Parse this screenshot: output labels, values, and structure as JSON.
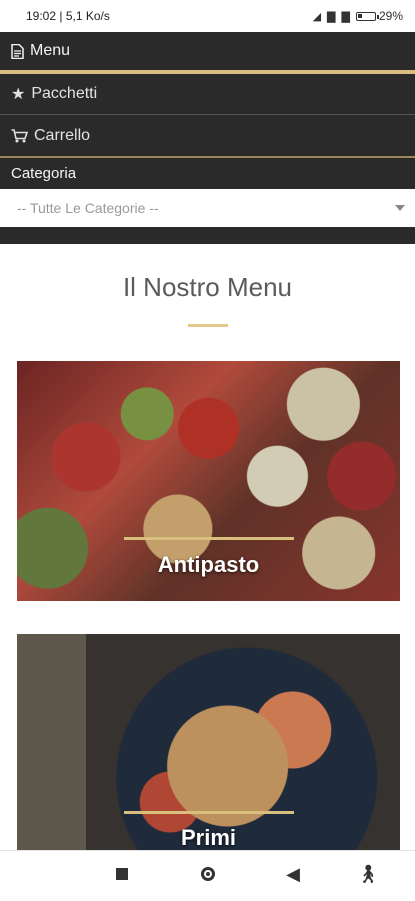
{
  "status_bar": {
    "time": "19:02",
    "speed": "5,1 Ko/s",
    "signal1": "⁴ᴳ",
    "signal2": "⁴ᴳ",
    "battery_text": "29%",
    "battery_level": 0.29
  },
  "nav": {
    "menu_label": "Menu",
    "packages_label": "Pacchetti",
    "cart_label": "Carrello",
    "category_label": "Categoria",
    "category_select_value": "-- Tutte Le Categorie --"
  },
  "main": {
    "heading": "Il Nostro Menu",
    "cards": [
      {
        "title": "Antipasto"
      },
      {
        "title": "Primi"
      }
    ]
  },
  "icons": {
    "menu": "document-icon",
    "packages": "star-icon",
    "cart": "cart-icon"
  },
  "colors": {
    "nav_bg": "#2a2a2a",
    "accent_gold": "#d9bf7e"
  }
}
